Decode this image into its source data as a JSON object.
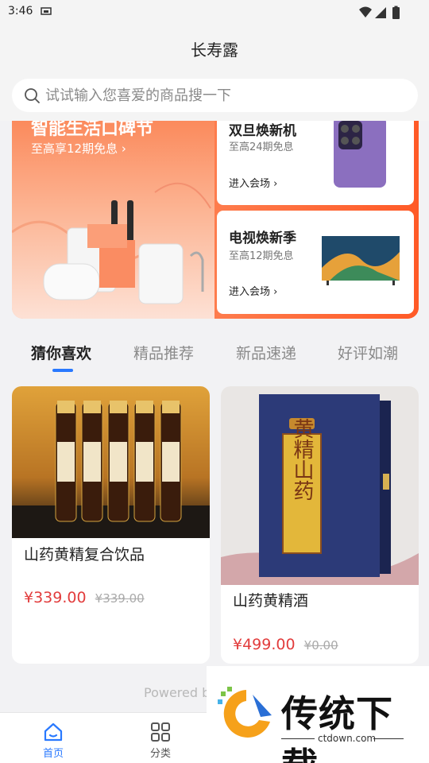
{
  "status_bar": {
    "time": "3:46"
  },
  "header": {
    "title": "长寿露"
  },
  "search": {
    "placeholder": "试试输入您喜爱的商品搜一下"
  },
  "banner": {
    "main_title": "智能生活口碑节",
    "main_subtitle": "至高享12期免息 ›",
    "promos": [
      {
        "title": "双旦焕新机",
        "subtitle": "至高24期免息",
        "link": "进入会场 ›"
      },
      {
        "title": "电视焕新季",
        "subtitle": "至高12期免息",
        "link": "进入会场 ›"
      }
    ]
  },
  "tabs": [
    {
      "label": "猜你喜欢",
      "active": true
    },
    {
      "label": "精品推荐",
      "active": false
    },
    {
      "label": "新品速递",
      "active": false
    },
    {
      "label": "好评如潮",
      "active": false
    }
  ],
  "products": [
    {
      "name": "山药黄精复合饮品",
      "price": "¥339.00",
      "original_price": "¥339.00"
    },
    {
      "name": "山药黄精酒",
      "price": "¥499.00",
      "original_price": "¥0.00",
      "box_label": "黄精山药"
    }
  ],
  "footer": {
    "powered_text": "Powered b"
  },
  "bottom_nav": [
    {
      "label": "首页",
      "icon": "home-icon",
      "active": true
    },
    {
      "label": "分类",
      "icon": "category-grid-icon",
      "active": false
    }
  ],
  "watermark": {
    "text": "传统下载",
    "url": "ctdown.com"
  },
  "colors": {
    "accent": "#2979ff",
    "price": "#e23c3c",
    "banner_orange": "#ff5a27"
  }
}
